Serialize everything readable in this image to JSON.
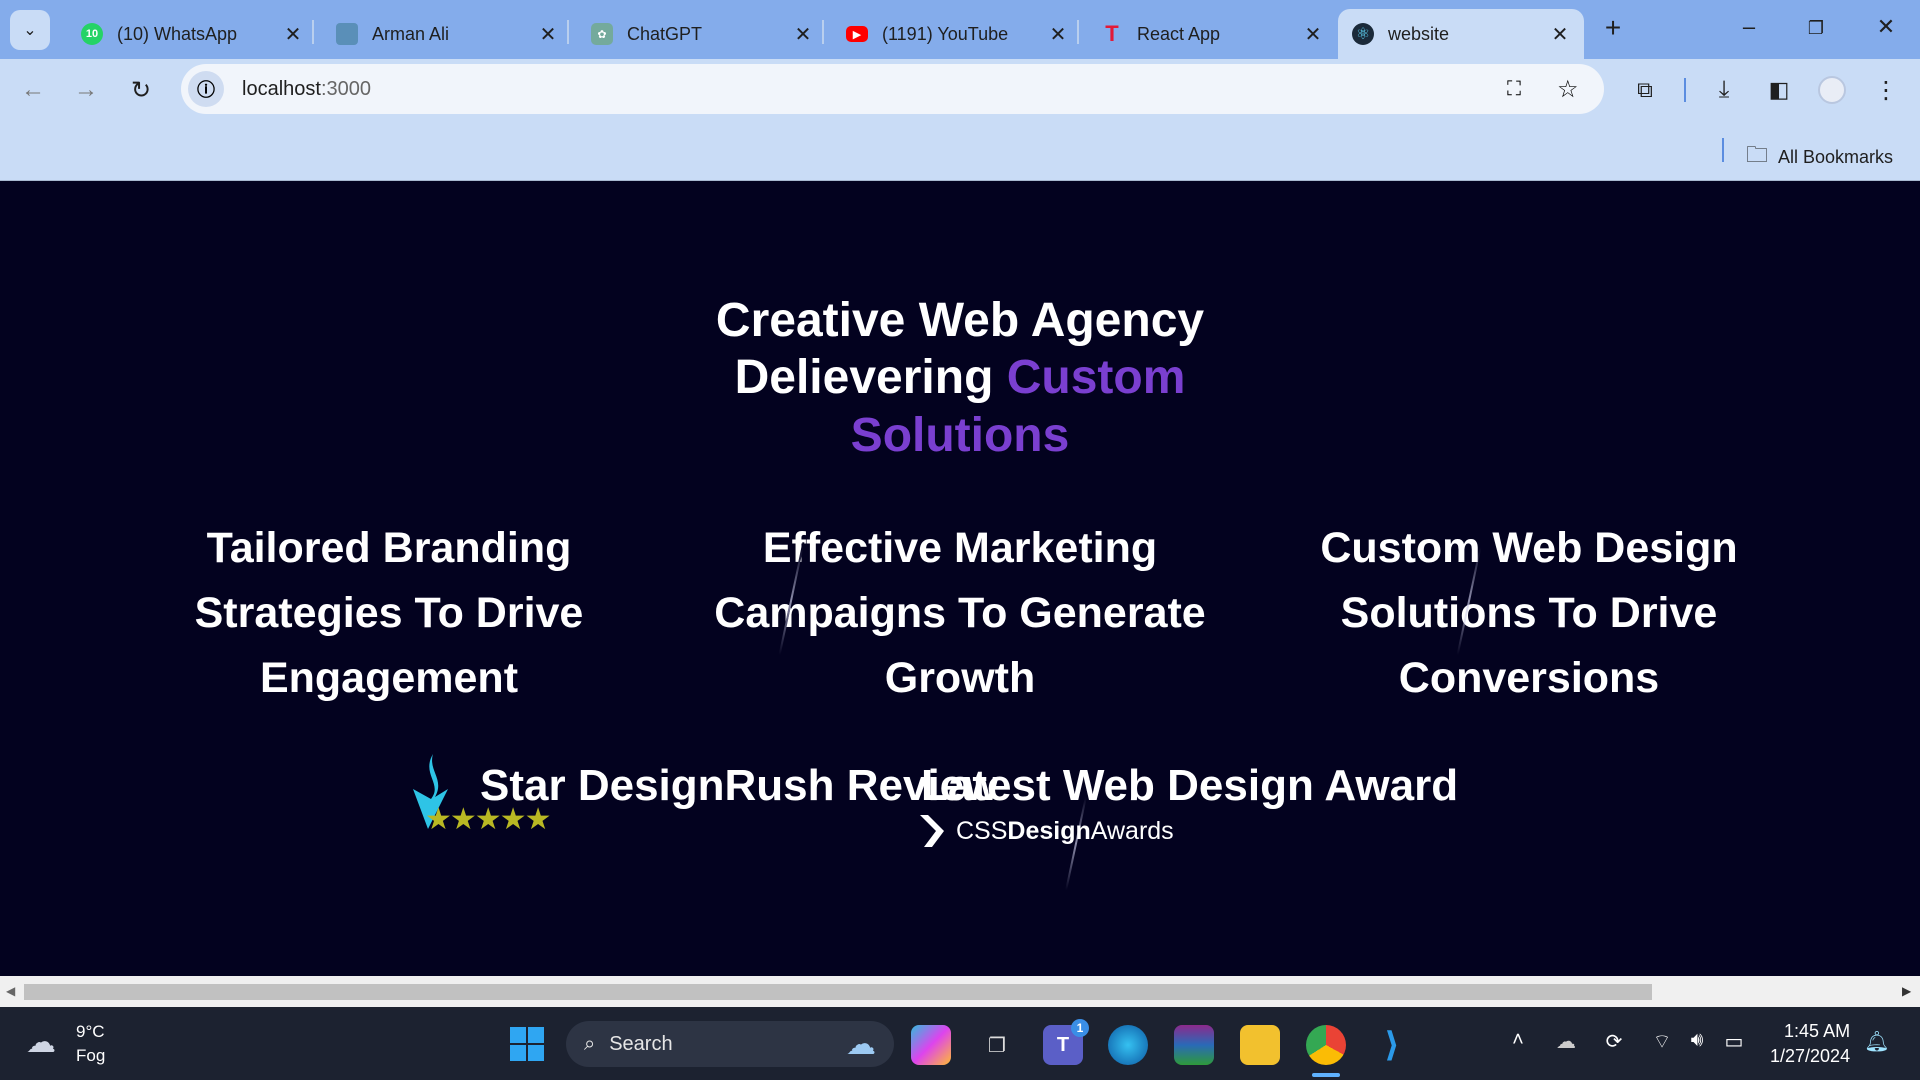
{
  "browser": {
    "tabs": [
      {
        "label": "(10) WhatsApp",
        "icon": "whatsapp-icon",
        "badge": "10",
        "color": "#25d366"
      },
      {
        "label": "Arman Ali",
        "icon": "avatar-icon",
        "color": "#5a8fb8"
      },
      {
        "label": "ChatGPT",
        "icon": "chatgpt-icon",
        "color": "#74aa9c"
      },
      {
        "label": "(1191) YouTube",
        "icon": "youtube-icon",
        "color": "#ff0000"
      },
      {
        "label": "React App",
        "icon": "tesla-icon",
        "color": "#e31937"
      },
      {
        "label": "website",
        "icon": "react-icon",
        "color": "#1b2a3a",
        "active": true
      }
    ],
    "url_host": "localhost",
    "url_port": ":3000",
    "bookmarks_label": "All Bookmarks"
  },
  "hero": {
    "line1": "Creative Web Agency",
    "line2_white": "Delievering ",
    "line2_purple": "Custom",
    "line3_purple": "Solutions",
    "accent": "#7a3fd0"
  },
  "services": [
    {
      "lines": [
        "Tailored Branding",
        "Strategies To Drive",
        "Engagement"
      ]
    },
    {
      "lines": [
        "Effective Marketing",
        "Campaigns To Generate",
        "Growth"
      ]
    },
    {
      "lines": [
        "Custom Web Design",
        "Solutions To Drive",
        "Conversions"
      ]
    }
  ],
  "awards": {
    "designrush": "Star DesignRush Review",
    "css": "Latest Web Design Award",
    "css_logo_light1": "CSS",
    "css_logo_bold": "Design",
    "css_logo_light2": "Awards",
    "star_rating": 5
  },
  "taskbar": {
    "temp": "9°C",
    "weather": "Fog",
    "search_placeholder": "Search",
    "time": "1:45 AM",
    "date": "1/27/2024",
    "teams_badge": "1"
  }
}
